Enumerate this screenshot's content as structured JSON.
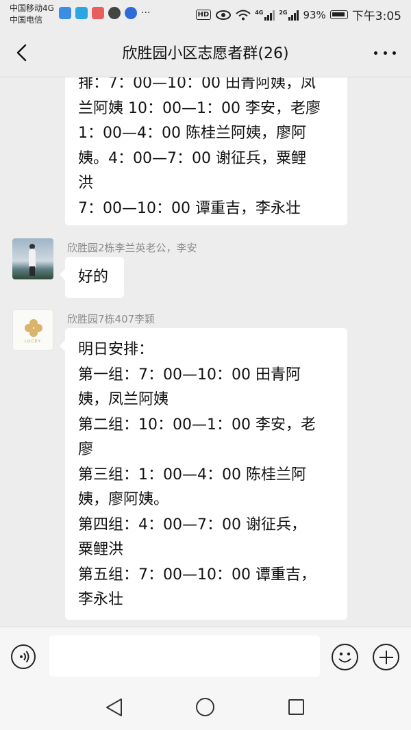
{
  "status_bar": {
    "carrier_1": "中国移动4G",
    "carrier_2": "中国电信",
    "hd_badge": "HD",
    "network_4g": "4G",
    "network_2g": "2G",
    "battery_percent": "93%",
    "time": "下午3:05"
  },
  "header": {
    "title": "欣胜园小区志愿者群(26)",
    "back_icon": "back-arrow-icon",
    "more_icon": "more-dots-icon"
  },
  "messages": [
    {
      "sender": "",
      "lines": [
        "排：7：00—10：00 田青阿姨，凤",
        "兰阿姨 10：00—1：00 李安，老廖",
        "1：00—4：00 陈桂兰阿姨，廖阿",
        "姨。4：00—7：00 谢征兵，粟鲤",
        "洪",
        "7：00—10：00 谭重吉，李永壮"
      ]
    },
    {
      "sender": "欣胜园2栋李兰英老公，李安",
      "text": "好的"
    },
    {
      "sender": "欣胜园7栋407李颖",
      "avatar_text": "LUCKY",
      "lines": [
        "明日安排：",
        "第一组：7：00—10：00 田青阿",
        "姨，凤兰阿姨",
        "第二组：10：00—1：00 李安，老",
        "廖",
        "第三组：1：00—4：00 陈桂兰阿",
        "姨，廖阿姨。",
        "第四组：4：00—7：00 谢征兵，",
        "粟鲤洪",
        "第五组：7：00—10：00 谭重吉，",
        "李永壮"
      ]
    }
  ],
  "input_bar": {
    "voice_icon": "voice-icon",
    "emoji_icon": "emoji-icon",
    "plus_icon": "plus-icon"
  }
}
